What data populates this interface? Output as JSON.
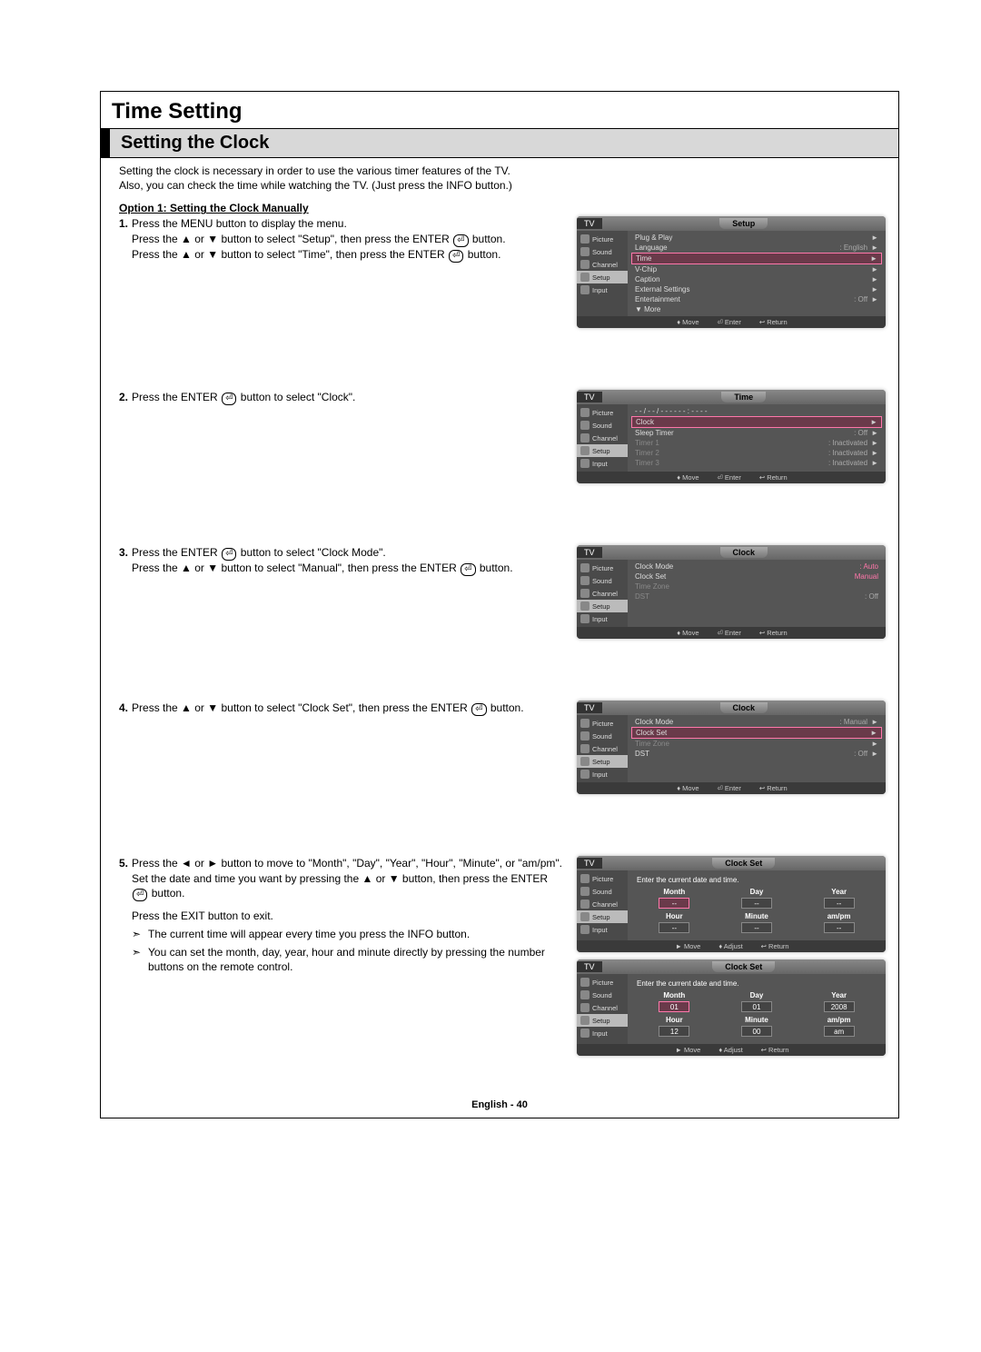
{
  "main_title": "Time Setting",
  "sub_title": "Setting the Clock",
  "intro_line1": "Setting the clock is necessary in order to use the various timer features of the TV.",
  "intro_line2": "Also, you can check the time while watching the TV. (Just press the INFO button.)",
  "option_title": "Option 1: Setting the Clock Manually",
  "steps": {
    "s1a": "Press the MENU button to display the menu.",
    "s1b_pre": "Press the ▲ or ▼ button to select \"Setup\", then press the ENTER",
    "s1b_post": "button.",
    "s1c_pre": "Press the ▲ or ▼ button to select \"Time\", then press the ENTER",
    "s1c_post": "button.",
    "s2_pre": "Press the ENTER",
    "s2_post": "button to select \"Clock\".",
    "s3a_pre": "Press the ENTER",
    "s3a_post": "button to select \"Clock Mode\".",
    "s3b_pre": "Press the ▲ or ▼ button to select \"Manual\", then press the ENTER",
    "s3b_post": "button.",
    "s4_pre": "Press the ▲ or ▼ button to select \"Clock Set\", then press the ENTER",
    "s4_post": "button.",
    "s5a_pre": "Press the ◄ or ► button to move to \"Month\", \"Day\", \"Year\", \"Hour\", \"Minute\", or \"am/pm\". Set the date and time you want by pressing the ▲ or ▼ button, then press the ENTER",
    "s5a_post": "button.",
    "s5b": "Press the EXIT button to exit.",
    "s5_note1": "The current time will appear every time you press the INFO button.",
    "s5_note2": "You can set the month, day, year, hour and minute directly by pressing the number buttons on the remote control."
  },
  "sidebar_items": [
    "Picture",
    "Sound",
    "Channel",
    "Setup",
    "Input"
  ],
  "osd_setup": {
    "tab": "Setup",
    "rows": [
      {
        "lbl": "Plug & Play",
        "val": "",
        "arrow": "►"
      },
      {
        "lbl": "Language",
        "val": ": English",
        "arrow": "►"
      },
      {
        "lbl": "Time",
        "val": "",
        "arrow": "►",
        "sel": true
      },
      {
        "lbl": "V-Chip",
        "val": "",
        "arrow": "►"
      },
      {
        "lbl": "Caption",
        "val": "",
        "arrow": "►"
      },
      {
        "lbl": "External Settings",
        "val": "",
        "arrow": "►"
      },
      {
        "lbl": "Entertainment",
        "val": ": Off",
        "arrow": "►"
      },
      {
        "lbl": "▼ More",
        "val": "",
        "arrow": ""
      }
    ]
  },
  "osd_time": {
    "tab": "Time",
    "header_time": "- - / - - / - - - -   - - : - -   - -",
    "rows": [
      {
        "lbl": "Clock",
        "val": "",
        "arrow": "►",
        "sel": true
      },
      {
        "lbl": "Sleep Timer",
        "val": ": Off",
        "arrow": "►"
      },
      {
        "lbl": "Timer 1",
        "val": ": Inactivated",
        "arrow": "►",
        "dim": true
      },
      {
        "lbl": "Timer 2",
        "val": ": Inactivated",
        "arrow": "►",
        "dim": true
      },
      {
        "lbl": "Timer 3",
        "val": ": Inactivated",
        "arrow": "►",
        "dim": true
      }
    ]
  },
  "osd_clock1": {
    "tab": "Clock",
    "rows": [
      {
        "lbl": "Clock Mode",
        "val": ": Auto",
        "pink": true
      },
      {
        "lbl": "Clock Set",
        "val": "Manual",
        "pink": true,
        "box": true
      },
      {
        "lbl": "Time Zone",
        "val": "",
        "dim": true
      },
      {
        "lbl": "DST",
        "val": ": Off",
        "dim": true
      }
    ]
  },
  "osd_clock2": {
    "tab": "Clock",
    "rows": [
      {
        "lbl": "Clock Mode",
        "val": ": Manual",
        "arrow": "►"
      },
      {
        "lbl": "Clock Set",
        "val": "",
        "arrow": "►",
        "sel": true
      },
      {
        "lbl": "Time Zone",
        "val": "",
        "arrow": "►",
        "dim": true
      },
      {
        "lbl": "DST",
        "val": ": Off",
        "arrow": "►"
      }
    ]
  },
  "osd_clockset_msg": "Enter the current date and time.",
  "cs_cols": [
    "Month",
    "Day",
    "Year",
    "Hour",
    "Minute",
    "am/pm"
  ],
  "cs_empty": "--",
  "cs_vals": [
    "01",
    "01",
    "2008",
    "12",
    "00",
    "am"
  ],
  "foot": {
    "move": "♦ Move",
    "enter": "⏎ Enter",
    "return": "↩ Return",
    "adjust": "♦ Adjust",
    "movelr": "► Move"
  },
  "tv_label": "TV",
  "clockset_tab": "Clock Set",
  "footnote": "English - 40"
}
